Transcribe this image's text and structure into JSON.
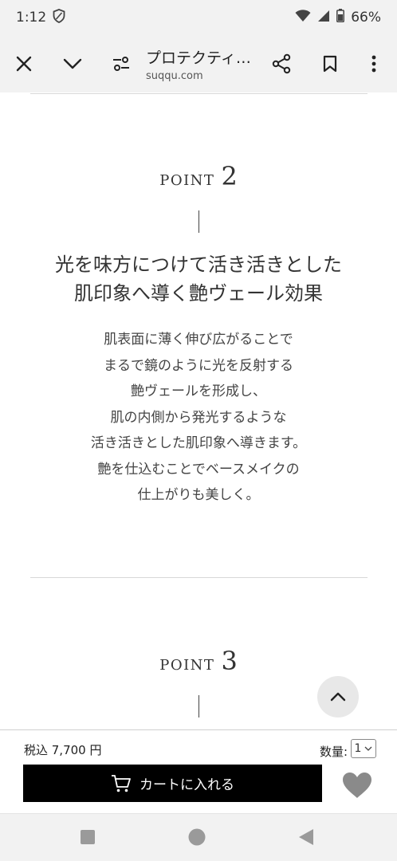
{
  "status_bar": {
    "time": "1:12",
    "battery": "66%"
  },
  "browser": {
    "title": "プロテクティ…",
    "domain": "suqqu.com"
  },
  "points": [
    {
      "word": "POINT",
      "number": "2",
      "catch_lines": [
        "光を味方につけて活き活きとした",
        "肌印象へ導く艶ヴェール効果"
      ],
      "body_lines": [
        "肌表面に薄く伸び広がることで",
        "まるで鏡のように光を反射する",
        "艶ヴェールを形成し、",
        "肌の内側から発光するような",
        "活き活きとした肌印象へ導きます。",
        "艶を仕込むことでベースメイクの",
        "仕上がりも美しく。"
      ]
    },
    {
      "word": "POINT",
      "number": "3"
    }
  ],
  "purchase": {
    "price": "税込 7,700 円",
    "quantity_label": "数量:",
    "quantity_value": "1",
    "cart_label": "カートに入れる"
  }
}
